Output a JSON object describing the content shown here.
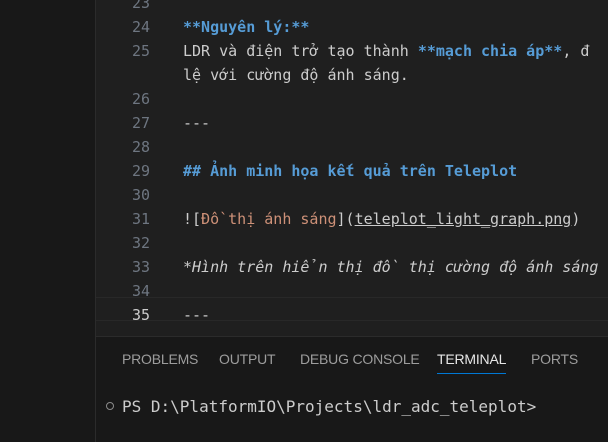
{
  "editor": {
    "lines": [
      {
        "num": "23",
        "segments": []
      },
      {
        "num": "24",
        "segments": [
          {
            "t": "**Nguyên lý:**",
            "c": "b"
          }
        ]
      },
      {
        "num": "25",
        "segments": [
          {
            "t": "LDR và điện trở tạo thành ",
            "c": ""
          },
          {
            "t": "**mạch chia áp**",
            "c": "b"
          },
          {
            "t": ", đ",
            "c": ""
          }
        ]
      },
      {
        "num": "",
        "segments": [
          {
            "t": "lệ với cường độ ánh sáng.",
            "c": ""
          }
        ]
      },
      {
        "num": "26",
        "segments": []
      },
      {
        "num": "27",
        "segments": [
          {
            "t": "---",
            "c": ""
          }
        ]
      },
      {
        "num": "28",
        "segments": []
      },
      {
        "num": "29",
        "segments": [
          {
            "t": "## Ảnh minh họa kết quả trên Teleplot",
            "c": "h"
          }
        ]
      },
      {
        "num": "30",
        "segments": []
      },
      {
        "num": "31",
        "segments": [
          {
            "t": "![",
            "c": "bracket"
          },
          {
            "t": "Đồ thị ánh sáng",
            "c": "alt"
          },
          {
            "t": "](",
            "c": "bracket"
          },
          {
            "t": "teleplot_light_graph.png",
            "c": "url"
          },
          {
            "t": ")",
            "c": "bracket"
          }
        ]
      },
      {
        "num": "32",
        "segments": []
      },
      {
        "num": "33",
        "segments": [
          {
            "t": "*Hình trên hiển thị đồ thị cường độ ánh sáng",
            "c": "it"
          }
        ]
      },
      {
        "num": "34",
        "segments": []
      },
      {
        "num": "35",
        "segments": [
          {
            "t": "---",
            "c": ""
          }
        ]
      }
    ],
    "active_line": "35"
  },
  "panel": {
    "tabs": [
      "PROBLEMS",
      "OUTPUT",
      "DEBUG CONSOLE",
      "TERMINAL",
      "PORTS"
    ],
    "active_tab": "TERMINAL",
    "terminal_prompt": "PS D:\\PlatformIO\\Projects\\ldr_adc_teleplot>"
  },
  "colors": {
    "editor_bg": "#1f1f1f",
    "panel_bg": "#181818",
    "bold": "#569cd6",
    "link_text": "#ce9178",
    "accent": "#0078d4"
  }
}
